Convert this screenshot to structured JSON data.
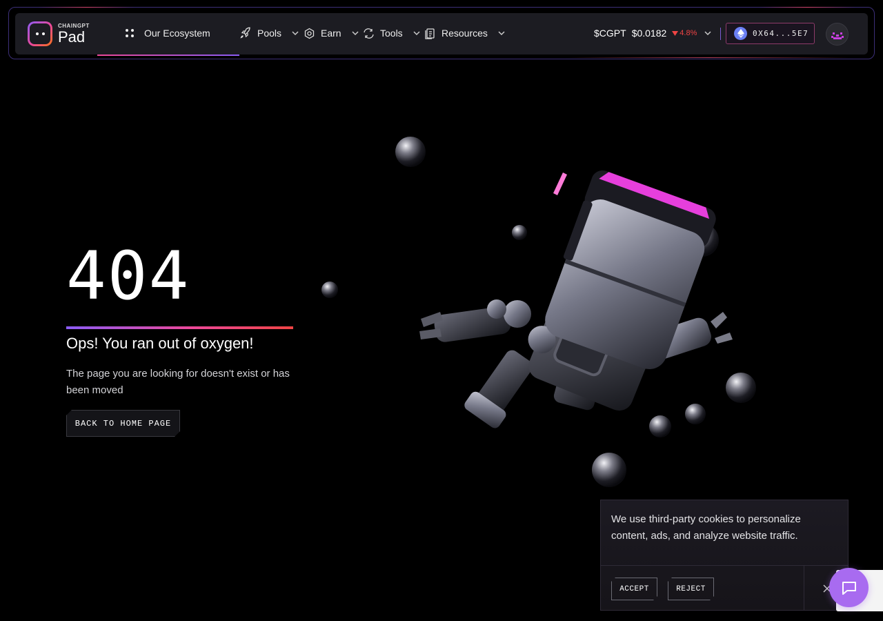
{
  "header": {
    "logo": {
      "small": "CHAINGPT",
      "big": "Pad"
    },
    "nav": [
      {
        "label": "Our Ecosystem",
        "icon": "grid-dots-icon",
        "has_dropdown": false
      },
      {
        "label": "Pools",
        "icon": "rocket-icon",
        "has_dropdown": true
      },
      {
        "label": "Earn",
        "icon": "hexagon-coin-icon",
        "has_dropdown": true
      },
      {
        "label": "Tools",
        "icon": "exchange-icon",
        "has_dropdown": true
      },
      {
        "label": "Resources",
        "icon": "document-icon",
        "has_dropdown": true
      }
    ],
    "token": {
      "symbol": "$CGPT",
      "price": "$0.0182",
      "change": "4.8%",
      "direction": "down"
    },
    "wallet": {
      "address": "0X64...5E7",
      "network_icon": "ethereum-icon"
    },
    "avatar_icon": "robot-face-icon"
  },
  "main": {
    "code": "404",
    "title": "Ops! You ran out of oxygen!",
    "description": "The page you are looking for doesn't exist or has been moved",
    "button": "BACK TO HOME PAGE"
  },
  "cookie": {
    "text": "We use third-party cookies to personalize content, ads, and analyze website traffic.",
    "accept": "ACCEPT",
    "reject": "REJECT"
  },
  "colors": {
    "background": "#000000",
    "navbar": "#1c1c22",
    "accent_purple": "#8b5cf6",
    "accent_pink": "#ec4899",
    "accent_red": "#ef4444",
    "chat_button": "#a86bf0"
  }
}
